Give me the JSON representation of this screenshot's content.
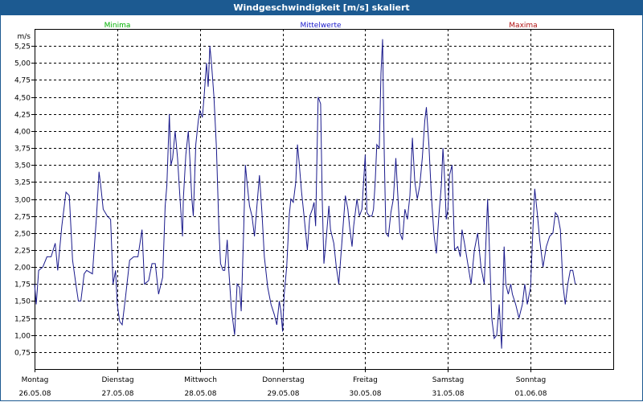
{
  "window": {
    "title": "Windgeschwindigkeit [m/s] skaliert"
  },
  "legend": [
    {
      "label": "Minima",
      "color": "#00b000"
    },
    {
      "label": "Mittelwerte",
      "color": "#1a1acc"
    },
    {
      "label": "Maxima",
      "color": "#b01010"
    }
  ],
  "chart_data": {
    "type": "line",
    "ylabel": "m/s",
    "ylim": [
      0.5,
      5.5
    ],
    "y_ticks": [
      "0,75",
      "1,00",
      "1,25",
      "1,50",
      "1,75",
      "2,00",
      "2,25",
      "2,50",
      "2,75",
      "3,00",
      "3,25",
      "3,50",
      "3,75",
      "4,00",
      "4,25",
      "4,50",
      "4,75",
      "5,00",
      "5,25"
    ],
    "y_tick_values": [
      0.75,
      1.0,
      1.25,
      1.5,
      1.75,
      2.0,
      2.25,
      2.5,
      2.75,
      3.0,
      3.25,
      3.5,
      3.75,
      4.0,
      4.25,
      4.5,
      4.75,
      5.0,
      5.25
    ],
    "x_range": [
      0,
      7
    ],
    "days": [
      {
        "day": "Montag",
        "date": "26.05.08",
        "x": 0
      },
      {
        "day": "Dienstag",
        "date": "27.05.08",
        "x": 1
      },
      {
        "day": "Mittwoch",
        "date": "28.05.08",
        "x": 2
      },
      {
        "day": "Donnerstag",
        "date": "29.05.08",
        "x": 3
      },
      {
        "day": "Freitag",
        "date": "30.05.08",
        "x": 4
      },
      {
        "day": "Samstag",
        "date": "31.05.08",
        "x": 5
      },
      {
        "day": "Sonntag",
        "date": "01.06.08",
        "x": 6
      }
    ],
    "grid": true,
    "series": [
      {
        "name": "Mittelwerte",
        "color": "#1a1a8c",
        "points": [
          [
            0.0,
            1.75
          ],
          [
            0.02,
            1.45
          ],
          [
            0.05,
            1.95
          ],
          [
            0.1,
            2.0
          ],
          [
            0.15,
            2.15
          ],
          [
            0.2,
            2.15
          ],
          [
            0.25,
            2.35
          ],
          [
            0.28,
            1.95
          ],
          [
            0.33,
            2.6
          ],
          [
            0.38,
            3.1
          ],
          [
            0.42,
            3.05
          ],
          [
            0.46,
            2.1
          ],
          [
            0.5,
            1.75
          ],
          [
            0.53,
            1.5
          ],
          [
            0.56,
            1.5
          ],
          [
            0.6,
            1.9
          ],
          [
            0.63,
            1.95
          ],
          [
            0.7,
            1.9
          ],
          [
            0.75,
            2.75
          ],
          [
            0.78,
            3.4
          ],
          [
            0.8,
            3.2
          ],
          [
            0.83,
            2.85
          ],
          [
            0.88,
            2.75
          ],
          [
            0.92,
            2.7
          ],
          [
            0.95,
            1.75
          ],
          [
            0.98,
            1.95
          ],
          [
            1.0,
            1.45
          ],
          [
            1.03,
            1.2
          ],
          [
            1.06,
            1.15
          ],
          [
            1.1,
            1.55
          ],
          [
            1.15,
            2.1
          ],
          [
            1.2,
            2.15
          ],
          [
            1.25,
            2.15
          ],
          [
            1.3,
            2.55
          ],
          [
            1.33,
            1.75
          ],
          [
            1.38,
            1.8
          ],
          [
            1.42,
            2.05
          ],
          [
            1.46,
            2.05
          ],
          [
            1.5,
            1.6
          ],
          [
            1.55,
            1.85
          ],
          [
            1.58,
            2.9
          ],
          [
            1.6,
            3.2
          ],
          [
            1.63,
            4.25
          ],
          [
            1.65,
            3.5
          ],
          [
            1.67,
            3.6
          ],
          [
            1.7,
            4.0
          ],
          [
            1.73,
            3.6
          ],
          [
            1.76,
            3.0
          ],
          [
            1.79,
            2.45
          ],
          [
            1.8,
            3.0
          ],
          [
            1.83,
            3.65
          ],
          [
            1.86,
            4.0
          ],
          [
            1.88,
            3.55
          ],
          [
            1.9,
            3.05
          ],
          [
            1.92,
            2.75
          ],
          [
            1.95,
            3.8
          ],
          [
            1.98,
            4.15
          ],
          [
            2.0,
            4.3
          ],
          [
            2.03,
            4.2
          ],
          [
            2.05,
            4.5
          ],
          [
            2.08,
            5.0
          ],
          [
            2.1,
            4.65
          ],
          [
            2.12,
            5.25
          ],
          [
            2.14,
            5.0
          ],
          [
            2.17,
            4.5
          ],
          [
            2.2,
            3.75
          ],
          [
            2.23,
            2.55
          ],
          [
            2.25,
            2.05
          ],
          [
            2.28,
            1.95
          ],
          [
            2.3,
            1.95
          ],
          [
            2.33,
            2.4
          ],
          [
            2.35,
            1.95
          ],
          [
            2.38,
            1.4
          ],
          [
            2.42,
            1.0
          ],
          [
            2.45,
            1.75
          ],
          [
            2.48,
            1.7
          ],
          [
            2.5,
            1.35
          ],
          [
            2.53,
            2.55
          ],
          [
            2.55,
            3.5
          ],
          [
            2.57,
            3.25
          ],
          [
            2.6,
            2.9
          ],
          [
            2.63,
            2.75
          ],
          [
            2.66,
            2.45
          ],
          [
            2.7,
            3.05
          ],
          [
            2.72,
            3.35
          ],
          [
            2.75,
            2.8
          ],
          [
            2.78,
            2.15
          ],
          [
            2.82,
            1.7
          ],
          [
            2.86,
            1.45
          ],
          [
            2.9,
            1.3
          ],
          [
            2.93,
            1.15
          ],
          [
            2.96,
            1.5
          ],
          [
            2.98,
            1.35
          ],
          [
            3.0,
            1.05
          ],
          [
            3.02,
            1.6
          ],
          [
            3.05,
            2.0
          ],
          [
            3.08,
            2.75
          ],
          [
            3.1,
            3.0
          ],
          [
            3.13,
            2.95
          ],
          [
            3.16,
            3.25
          ],
          [
            3.18,
            3.8
          ],
          [
            3.2,
            3.55
          ],
          [
            3.23,
            3.1
          ],
          [
            3.26,
            2.75
          ],
          [
            3.3,
            2.25
          ],
          [
            3.33,
            2.75
          ],
          [
            3.36,
            2.85
          ],
          [
            3.38,
            2.95
          ],
          [
            3.4,
            2.6
          ],
          [
            3.43,
            4.5
          ],
          [
            3.46,
            4.4
          ],
          [
            3.48,
            3.0
          ],
          [
            3.5,
            2.05
          ],
          [
            3.53,
            2.45
          ],
          [
            3.56,
            2.9
          ],
          [
            3.58,
            2.55
          ],
          [
            3.62,
            2.35
          ],
          [
            3.65,
            2.0
          ],
          [
            3.68,
            1.75
          ],
          [
            3.72,
            2.4
          ],
          [
            3.76,
            3.05
          ],
          [
            3.79,
            2.85
          ],
          [
            3.81,
            2.6
          ],
          [
            3.84,
            2.3
          ],
          [
            3.86,
            2.6
          ],
          [
            3.9,
            3.0
          ],
          [
            3.93,
            2.75
          ],
          [
            3.96,
            2.85
          ],
          [
            4.0,
            3.65
          ],
          [
            4.02,
            2.8
          ],
          [
            4.05,
            2.75
          ],
          [
            4.08,
            2.75
          ],
          [
            4.1,
            2.85
          ],
          [
            4.12,
            3.25
          ],
          [
            4.14,
            3.8
          ],
          [
            4.17,
            3.75
          ],
          [
            4.19,
            4.85
          ],
          [
            4.21,
            5.35
          ],
          [
            4.23,
            3.65
          ],
          [
            4.25,
            2.5
          ],
          [
            4.28,
            2.45
          ],
          [
            4.31,
            2.8
          ],
          [
            4.34,
            3.0
          ],
          [
            4.37,
            3.6
          ],
          [
            4.39,
            3.15
          ],
          [
            4.42,
            2.5
          ],
          [
            4.45,
            2.4
          ],
          [
            4.48,
            2.85
          ],
          [
            4.51,
            2.7
          ],
          [
            4.54,
            3.05
          ],
          [
            4.57,
            3.9
          ],
          [
            4.6,
            3.25
          ],
          [
            4.63,
            3.0
          ],
          [
            4.66,
            3.2
          ],
          [
            4.69,
            3.6
          ],
          [
            4.72,
            4.15
          ],
          [
            4.74,
            4.35
          ],
          [
            4.77,
            3.8
          ],
          [
            4.8,
            3.05
          ],
          [
            4.83,
            2.5
          ],
          [
            4.86,
            2.2
          ],
          [
            4.89,
            2.75
          ],
          [
            4.92,
            3.2
          ],
          [
            4.94,
            3.75
          ],
          [
            4.96,
            3.3
          ],
          [
            4.98,
            2.7
          ],
          [
            5.0,
            2.85
          ],
          [
            5.02,
            3.35
          ],
          [
            5.05,
            3.5
          ],
          [
            5.08,
            2.25
          ],
          [
            5.12,
            2.3
          ],
          [
            5.15,
            2.15
          ],
          [
            5.17,
            2.55
          ],
          [
            5.2,
            2.35
          ],
          [
            5.24,
            2.05
          ],
          [
            5.28,
            1.75
          ],
          [
            5.32,
            2.25
          ],
          [
            5.36,
            2.5
          ],
          [
            5.4,
            2.0
          ],
          [
            5.44,
            1.75
          ],
          [
            5.48,
            3.0
          ],
          [
            5.5,
            2.35
          ],
          [
            5.53,
            1.25
          ],
          [
            5.56,
            0.95
          ],
          [
            5.59,
            1.0
          ],
          [
            5.62,
            1.45
          ],
          [
            5.65,
            0.8
          ],
          [
            5.68,
            2.3
          ],
          [
            5.7,
            1.75
          ],
          [
            5.73,
            1.6
          ],
          [
            5.76,
            1.75
          ],
          [
            5.78,
            1.6
          ],
          [
            5.82,
            1.45
          ],
          [
            5.86,
            1.25
          ],
          [
            5.9,
            1.45
          ],
          [
            5.93,
            1.75
          ],
          [
            5.96,
            1.45
          ],
          [
            6.0,
            1.7
          ],
          [
            6.03,
            2.6
          ],
          [
            6.05,
            3.15
          ],
          [
            6.08,
            2.8
          ],
          [
            6.11,
            2.4
          ],
          [
            6.15,
            2.0
          ],
          [
            6.19,
            2.3
          ],
          [
            6.23,
            2.45
          ],
          [
            6.27,
            2.5
          ],
          [
            6.3,
            2.8
          ],
          [
            6.33,
            2.75
          ],
          [
            6.36,
            2.55
          ],
          [
            6.39,
            1.75
          ],
          [
            6.42,
            1.45
          ],
          [
            6.45,
            1.75
          ],
          [
            6.48,
            1.95
          ],
          [
            6.51,
            1.95
          ],
          [
            6.54,
            1.75
          ]
        ]
      }
    ]
  }
}
